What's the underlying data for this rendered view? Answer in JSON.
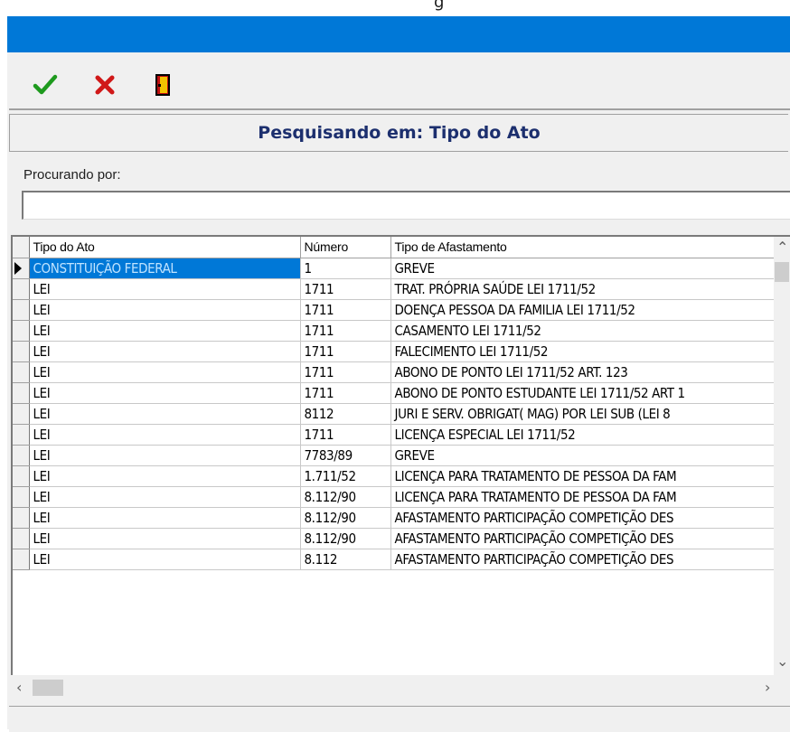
{
  "window": {
    "title_fragment": "g",
    "titlebar_color": "#0078d7"
  },
  "toolbar": {
    "confirm_icon": "check-icon",
    "cancel_icon": "x-icon",
    "exit_icon": "door-exit-icon"
  },
  "search": {
    "header": "Pesquisando em: Tipo do Ato",
    "label": "Procurando por:",
    "value": ""
  },
  "grid": {
    "columns": [
      "Tipo do Ato",
      "Número",
      "Tipo de Afastamento"
    ],
    "selected_row": 0,
    "rows": [
      [
        "CONSTITUIÇÃO FEDERAL",
        "1",
        "GREVE"
      ],
      [
        "LEI",
        "1711",
        "TRAT. PRÓPRIA SAÚDE LEI 1711/52"
      ],
      [
        "LEI",
        "1711",
        "DOENÇA PESSOA DA FAMILIA LEI 1711/52"
      ],
      [
        "LEI",
        "1711",
        "CASAMENTO LEI 1711/52"
      ],
      [
        "LEI",
        "1711",
        "FALECIMENTO LEI 1711/52"
      ],
      [
        "LEI",
        "1711",
        "ABONO DE PONTO LEI 1711/52  ART. 123"
      ],
      [
        "LEI",
        "1711",
        "ABONO DE PONTO ESTUDANTE LEI 1711/52 ART 1"
      ],
      [
        "LEI",
        "8112",
        "JURI E SERV. OBRIGAT( MAG) POR LEI SUB (LEI 8"
      ],
      [
        "LEI",
        "1711",
        "LICENÇA ESPECIAL LEI 1711/52"
      ],
      [
        "LEI",
        "7783/89",
        "GREVE"
      ],
      [
        "LEI",
        "1.711/52",
        "LICENÇA PARA TRATAMENTO DE PESSOA DA FAM"
      ],
      [
        "LEI",
        "8.112/90",
        "LICENÇA PARA TRATAMENTO DE PESSOA DA FAM"
      ],
      [
        "LEI",
        "8.112/90",
        "AFASTAMENTO PARTICIPAÇÃO COMPETIÇÃO DES"
      ],
      [
        "LEI",
        "8.112/90",
        "AFASTAMENTO PARTICIPAÇÃO COMPETIÇÃO DES"
      ],
      [
        "LEI",
        "8.112",
        "AFASTAMENTO PARTICIPAÇÃO COMPETIÇÃO DES"
      ]
    ]
  },
  "scrollbars": {
    "up_icon": "chevron-up-icon",
    "down_icon": "chevron-down-icon",
    "left_icon": "chevron-left-icon",
    "right_icon": "chevron-right-icon"
  }
}
